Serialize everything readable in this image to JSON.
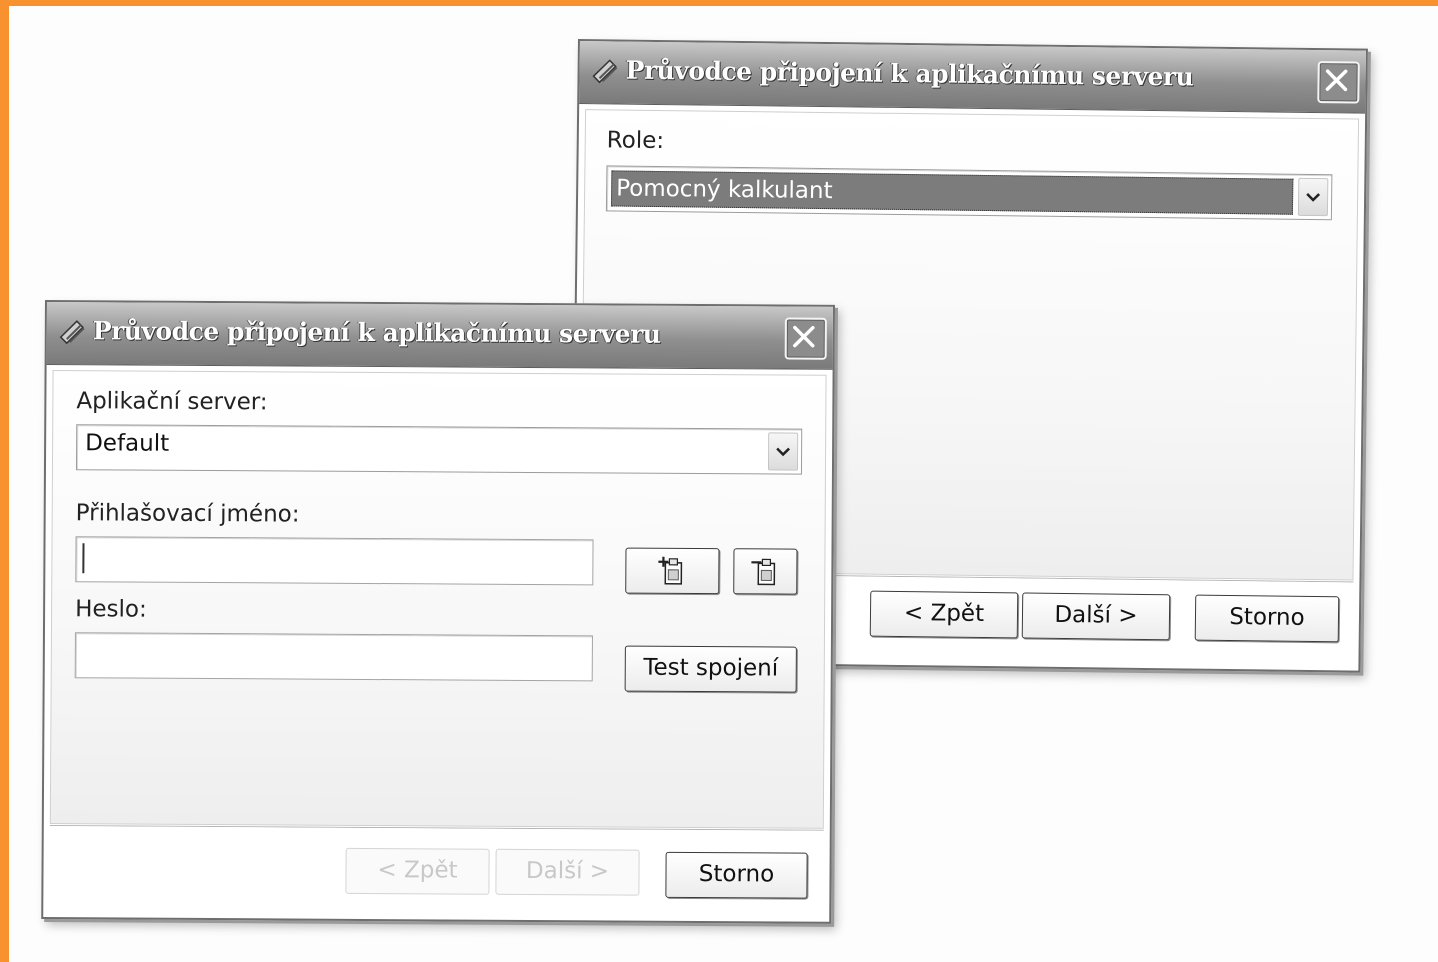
{
  "back_dialog": {
    "title": "Průvodce připojení k aplikačnímu serveru",
    "role_label": "Role:",
    "role_value": "Pomocný kalkulant",
    "buttons": {
      "back": "< Zpět",
      "next": "Další >",
      "cancel": "Storno"
    }
  },
  "front_dialog": {
    "title": "Průvodce připojení k aplikačnímu serveru",
    "server_label": "Aplikační server:",
    "server_value": "Default",
    "login_label": "Přihlašovací jméno:",
    "login_value": "",
    "password_label": "Heslo:",
    "password_value": "",
    "test_button": "Test spojení",
    "buttons": {
      "back": "< Zpět",
      "next": "Další >",
      "cancel": "Storno"
    },
    "disabled_buttons": [
      "back",
      "next"
    ]
  },
  "icons": [
    "wizard-icon",
    "close-icon",
    "chevron-down-icon",
    "add-user-icon",
    "remove-user-icon"
  ],
  "colors": {
    "frame_accent": "#f7922f",
    "titlebar": "#8f8f8f",
    "selection": "#7c7c7c"
  }
}
